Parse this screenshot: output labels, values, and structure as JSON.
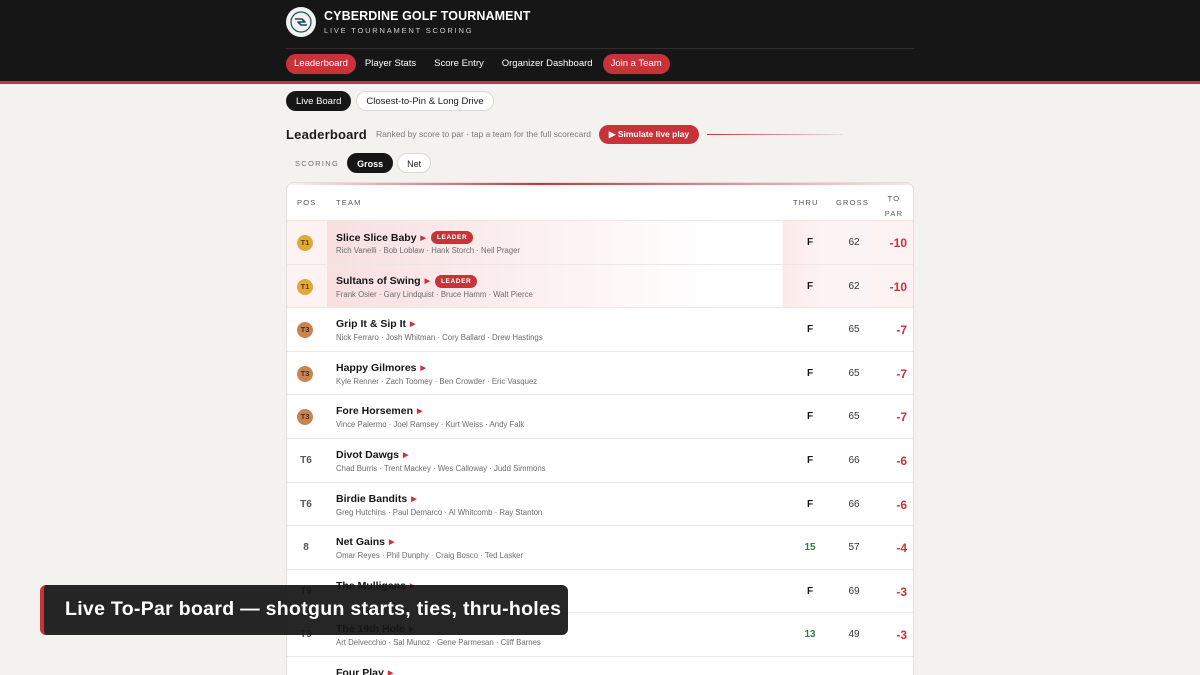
{
  "app": {
    "title": "CYBERDINE GOLF TOURNAMENT",
    "subtitle": "LIVE TOURNAMENT SCORING"
  },
  "nav": {
    "items": [
      {
        "label": "Leaderboard"
      },
      {
        "label": "Player Stats"
      },
      {
        "label": "Score Entry"
      },
      {
        "label": "Organizer Dashboard"
      },
      {
        "label": "Join a Team"
      }
    ]
  },
  "subtabs": [
    {
      "label": "Live Board"
    },
    {
      "label": "Closest-to-Pin & Long Drive"
    }
  ],
  "leaderboard": {
    "title": "Leaderboard",
    "description": "Ranked by score to par · tap a team for the full scorecard",
    "simulate_label": "▶ Simulate live play"
  },
  "scoring": {
    "label": "SCORING",
    "options": [
      "Gross",
      "Net"
    ],
    "selected": "Gross"
  },
  "table": {
    "headers": {
      "pos": "POS",
      "team": "TEAM",
      "thru": "THRU",
      "gross": "GROSS",
      "to_par_1": "TO",
      "to_par_2": "PAR"
    },
    "leader_badge": "LEADER",
    "rows": [
      {
        "pos": "T1",
        "team": "Slice Slice Baby",
        "players": "Rich Vanelli · Bob Loblaw · Hank Storch · Neil Prager",
        "thru": "F",
        "gross": "62",
        "to_par": "-10",
        "leader": true
      },
      {
        "pos": "T1",
        "team": "Sultans of Swing",
        "players": "Frank Osier · Gary Lindquist · Bruce Hamm · Walt Pierce",
        "thru": "F",
        "gross": "62",
        "to_par": "-10",
        "leader": true
      },
      {
        "pos": "T3",
        "team": "Grip It & Sip It",
        "players": "Nick Ferraro · Josh Whitman · Cory Ballard · Drew Hastings",
        "thru": "F",
        "gross": "65",
        "to_par": "-7",
        "leader": false
      },
      {
        "pos": "T3",
        "team": "Happy Gilmores",
        "players": "Kyle Renner · Zach Toomey · Ben Crowder · Eric Vasquez",
        "thru": "F",
        "gross": "65",
        "to_par": "-7",
        "leader": false
      },
      {
        "pos": "T3",
        "team": "Fore Horsemen",
        "players": "Vince Palermo · Joel Ramsey · Kurt Weiss · Andy Falk",
        "thru": "F",
        "gross": "65",
        "to_par": "-7",
        "leader": false
      },
      {
        "pos": "T6",
        "team": "Divot Dawgs",
        "players": "Chad Burris · Trent Mackey · Wes Calloway · Judd Simmons",
        "thru": "F",
        "gross": "66",
        "to_par": "-6",
        "leader": false
      },
      {
        "pos": "T6",
        "team": "Birdie Bandits",
        "players": "Greg Hutchins · Paul Demarco · Al Whitcomb · Ray Stanton",
        "thru": "F",
        "gross": "66",
        "to_par": "-6",
        "leader": false
      },
      {
        "pos": "8",
        "team": "Net Gains",
        "players": "Omar Reyes · Phil Dunphy · Craig Bosco · Ted Lasker",
        "thru": "15",
        "gross": "57",
        "to_par": "-4",
        "leader": false
      },
      {
        "pos": "T9",
        "team": "The Mulligans",
        "players": "",
        "thru": "F",
        "gross": "69",
        "to_par": "-3",
        "leader": false
      },
      {
        "pos": "T9",
        "team": "The 19th Hole",
        "players": "Art Delvecchio · Sal Munoz · Gene Parmesan · Cliff Barnes",
        "thru": "13",
        "gross": "49",
        "to_par": "-3",
        "leader": false
      },
      {
        "pos": "",
        "team": "Four Play",
        "players": "",
        "thru": "",
        "gross": "",
        "to_par": "",
        "leader": false
      }
    ]
  },
  "caption": {
    "text": "Live To-Par board — shotgun starts, ties, thru-holes"
  },
  "colors": {
    "accent": "#c8333a",
    "header_bg": "#161616",
    "page_bg": "#f4f2ee",
    "gold": "#e2a93a",
    "bronze": "#c88552",
    "green": "#2f7d43"
  }
}
